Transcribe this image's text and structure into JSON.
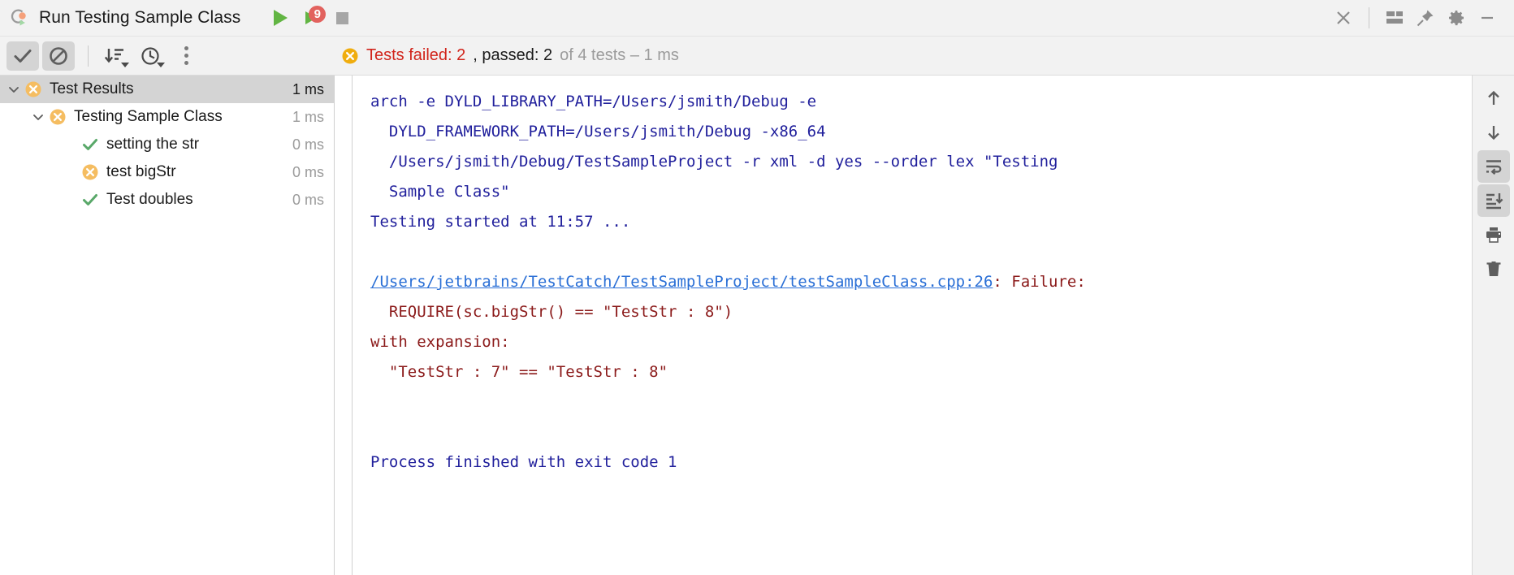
{
  "window": {
    "title": "Run Testing Sample Class",
    "app_icon": "clion-run-icon"
  },
  "titlebar_actions": {
    "run": "run-button",
    "rerun_failed_label": "9",
    "stop": "stop-button",
    "close": "close-button",
    "layout": "layout-button",
    "pin": "pin-button",
    "settings": "settings-button",
    "minimize": "minimize-button"
  },
  "toolbar": {
    "show_passed": "show-passed-toggle",
    "show_ignored": "show-ignored-toggle",
    "sort": "sort-alphabetically-button",
    "duration": "sort-by-duration-button",
    "more": "more-options-button"
  },
  "status": {
    "icon": "error-icon",
    "failed_text": "Tests failed: 2",
    "passed_text": ", passed: 2",
    "total_text": " of 4 tests – 1 ms"
  },
  "tree": [
    {
      "label": "Test Results",
      "time": "1 ms",
      "status": "failed",
      "indent": 0,
      "chevron": "down",
      "selected": true
    },
    {
      "label": "Testing Sample Class",
      "time": "1 ms",
      "status": "failed",
      "indent": 1,
      "chevron": "down",
      "selected": false
    },
    {
      "label": "setting the str",
      "time": "0 ms",
      "status": "passed",
      "indent": 2,
      "chevron": "none",
      "selected": false
    },
    {
      "label": "test bigStr",
      "time": "0 ms",
      "status": "failed",
      "indent": 2,
      "chevron": "none",
      "selected": false
    },
    {
      "label": "Test doubles",
      "time": "0 ms",
      "status": "passed",
      "indent": 2,
      "chevron": "none",
      "selected": false
    }
  ],
  "console": {
    "command_line": "arch -e DYLD_LIBRARY_PATH=/Users/jsmith/Debug -e\n  DYLD_FRAMEWORK_PATH=/Users/jsmith/Debug -x86_64\n  /Users/jsmith/Debug/TestSampleProject -r xml -d yes --order lex \"Testing\n  Sample Class\"",
    "started_line": "Testing started at 11:57 ...",
    "failure_link": "/Users/jetbrains/TestCatch/TestSampleProject/testSampleClass.cpp:26",
    "failure_suffix": ": Failure:",
    "failure_require": "  REQUIRE(sc.bigStr() == \"TestStr : 8\")",
    "failure_with": "with expansion:",
    "failure_expansion": "  \"TestStr : 7\" == \"TestStr : 8\"",
    "exit_line": "Process finished with exit code 1"
  },
  "rail": {
    "up": "scroll-up-button",
    "down": "scroll-down-button",
    "soft_wrap": "soft-wrap-button",
    "scroll_end": "scroll-to-end-button",
    "print": "print-button",
    "clear": "clear-all-button"
  },
  "colors": {
    "fail_red": "#d1241b",
    "pass_green": "#59a869",
    "error_orange": "#f0ad4e",
    "console_blue": "#21209c",
    "link_blue": "#2a6fd6",
    "assert_red": "#8b1a1a",
    "badge_red": "#e2625e",
    "play_green": "#62b543"
  }
}
